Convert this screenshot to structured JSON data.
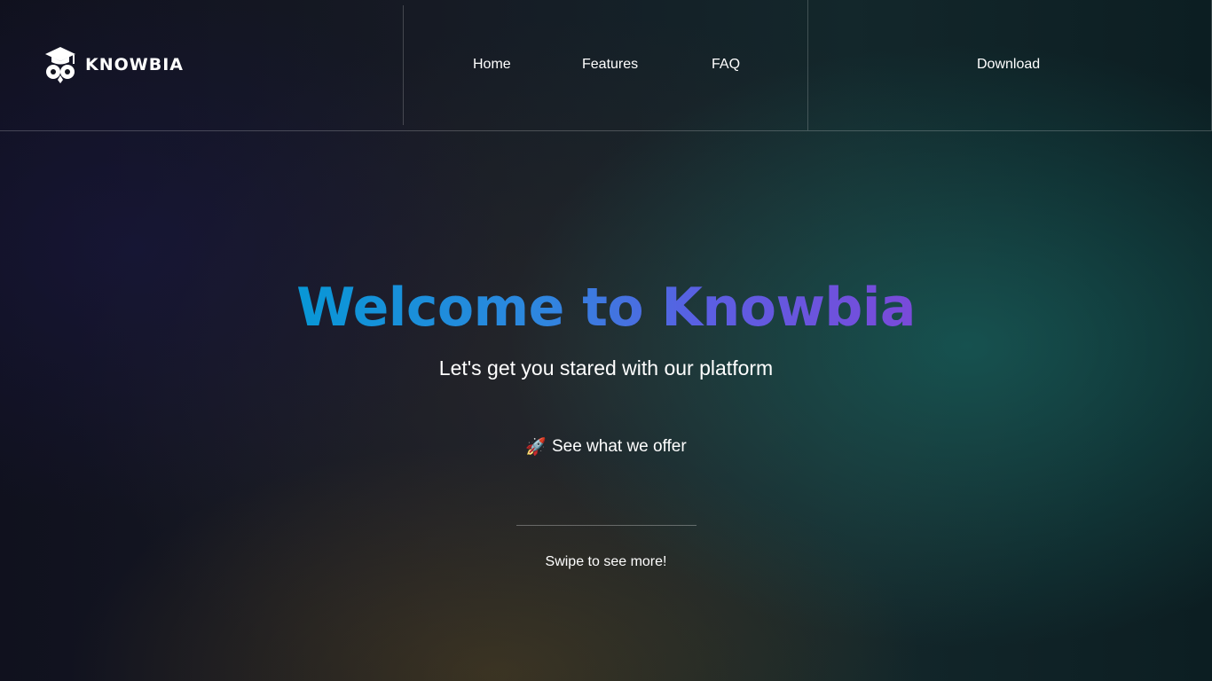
{
  "brand": {
    "name": "KNOWBIA",
    "logo_icon": "owl-graduation-cap-icon"
  },
  "nav": {
    "home": "Home",
    "features": "Features",
    "faq": "FAQ",
    "download": "Download"
  },
  "hero": {
    "title": "Welcome to Knowbia",
    "subtitle": "Let's get you stared with our platform",
    "cta_icon": "🚀",
    "cta_label": "See what we offer",
    "swipe_hint": "Swipe to see more!"
  },
  "colors": {
    "title_gradient_start": "#0897d6",
    "title_gradient_end": "#7a4ad9",
    "text": "#ffffff"
  }
}
